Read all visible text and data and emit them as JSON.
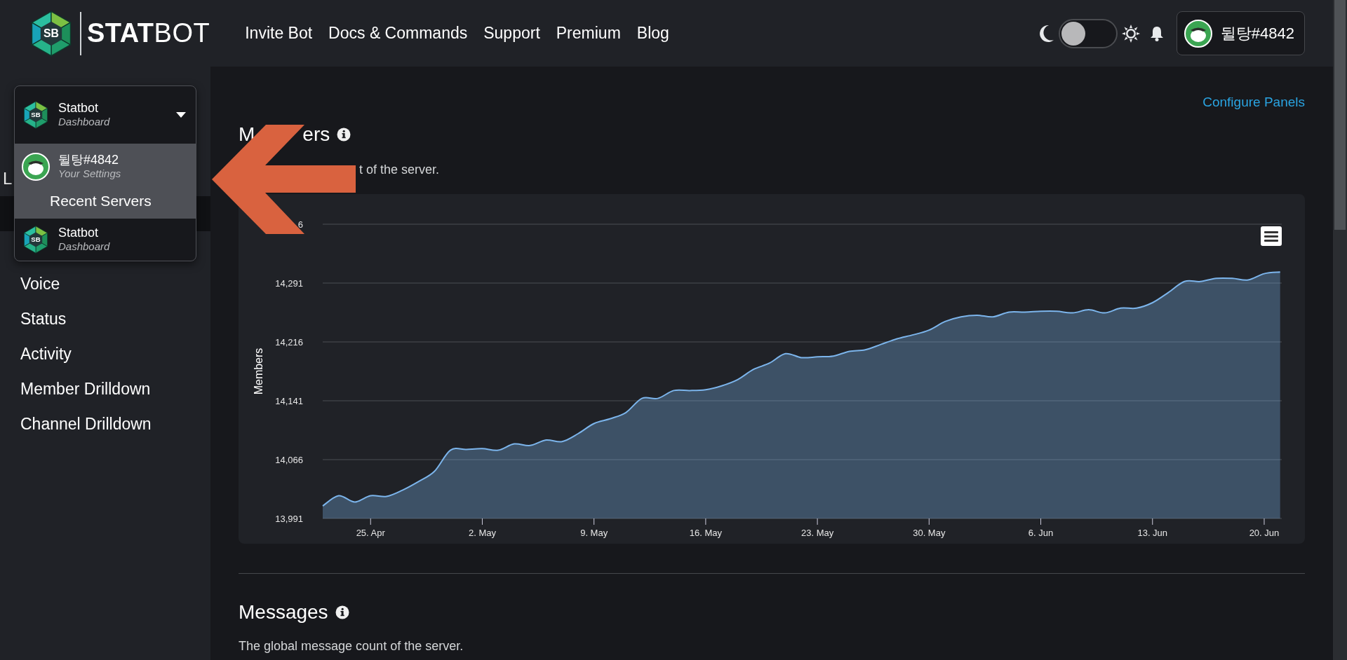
{
  "header": {
    "logo": {
      "initials": "SB",
      "wordmark": "**STAT**BOT"
    },
    "nav": [
      "Invite Bot",
      "Docs & Commands",
      "Support",
      "Premium",
      "Blog"
    ],
    "theme_toggle": {
      "on": false
    },
    "user": {
      "name": "뒬탕#4842"
    }
  },
  "server_picker": {
    "name": "Statbot",
    "subtitle": "Dashboard",
    "icon_text": "SB",
    "expanded": true,
    "menu": [
      {
        "kind": "user",
        "name": "뒬탕#4842",
        "subtitle": "Your Settings",
        "highlighted": true
      },
      {
        "kind": "heading",
        "label": "Recent Servers",
        "highlighted": true
      },
      {
        "kind": "server",
        "name": "Statbot",
        "subtitle": "Dashboard",
        "icon_text": "SB",
        "highlighted": false
      }
    ]
  },
  "sidebar": {
    "heading": "L",
    "items": [
      {
        "selected": true
      },
      {
        "selected": false
      },
      {
        "label": "Voice",
        "selected": false
      },
      {
        "label": "Status",
        "selected": false
      },
      {
        "label": "Activity",
        "selected": false
      },
      {
        "label": "Member Drilldown",
        "selected": false
      },
      {
        "label": "Channel Drilldown",
        "selected": false
      }
    ]
  },
  "main": {
    "configure_link": "Configure Panels",
    "panels": [
      {
        "title_parts": [
          "M",
          "ers"
        ],
        "obscured": true,
        "covered_tick_label": "6",
        "description": "t of the server.",
        "chart_data": {
          "type": "area",
          "ylabel": "Members",
          "categories": [
            null,
            null,
            null,
            "25. Apr",
            null,
            null,
            null,
            null,
            null,
            null,
            "2. May",
            null,
            null,
            null,
            null,
            null,
            null,
            "9. May",
            null,
            null,
            null,
            null,
            null,
            null,
            "16. May",
            null,
            null,
            null,
            null,
            null,
            null,
            "23. May",
            null,
            null,
            null,
            null,
            null,
            null,
            "30. May",
            null,
            null,
            null,
            null,
            null,
            null,
            "6. Jun",
            null,
            null,
            null,
            null,
            null,
            null,
            "13. Jun",
            null,
            null,
            null,
            null,
            null,
            null,
            "20. Jun",
            null
          ],
          "series": [
            {
              "color": "#7cb5ec",
              "values": [
                14007,
                14020,
                14012,
                14020,
                14019,
                14027,
                14038,
                14051,
                14078,
                14079,
                14080,
                14078,
                14086,
                14084,
                14091,
                14089,
                14099,
                14112,
                14118,
                14126,
                14144,
                14144,
                14154,
                14154,
                14155,
                14160,
                14168,
                14181,
                14189,
                14201,
                14196,
                14197,
                14198,
                14204,
                14206,
                14213,
                14220,
                14225,
                14231,
                14242,
                14248,
                14250,
                14248,
                14254,
                14254,
                14255,
                14255,
                14253,
                14257,
                14253,
                14259,
                14259,
                14266,
                14279,
                14293,
                14293,
                14297,
                14297,
                14295,
                14303,
                14305
              ]
            }
          ],
          "ylim": [
            13991,
            14366
          ],
          "yticks": [
            {
              "value": 13991,
              "label": "13,991"
            },
            {
              "value": 14066,
              "label": "14,066"
            },
            {
              "value": 14141,
              "label": "14,141"
            },
            {
              "value": 14216,
              "label": "14,216"
            },
            {
              "value": 14291,
              "label": "14,291"
            }
          ],
          "grid": true
        }
      },
      {
        "title_parts": [
          "Messages"
        ],
        "obscured": false,
        "description": "The global message count of the server."
      }
    ]
  },
  "annotation_arrow": {
    "kind": "arrow"
  }
}
